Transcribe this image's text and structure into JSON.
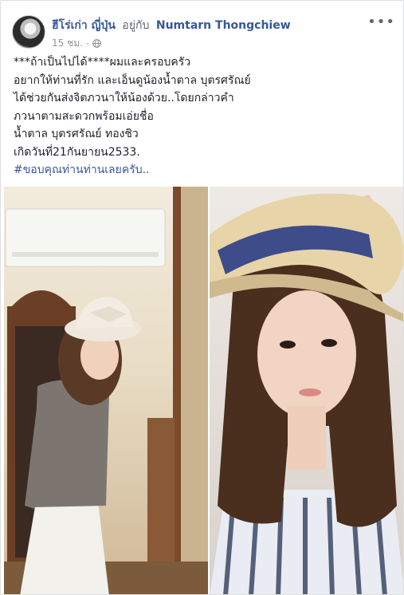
{
  "post": {
    "author": "ฮีโร่เก่า ญี่ปุ่น",
    "with_text": "อยู่กับ",
    "tagged_person": "Numtarn Thongchiew",
    "timestamp": "15 ชม.",
    "privacy_icon": "globe-icon",
    "more_icon": "more-options-icon",
    "lines": [
      "***ถ้าเป็นไปได้****ผมและครอบครัว",
      "อยากให้ท่านที่รัก และเอ็นดูน้องน้ำตาล บุตรศรัณย์",
      "ได้ช่วยกันส่งจิตภวนาให้น้องด้วย..โดยกล่าวคำ",
      "ภวนาตามสะดวกพร้อมเอ่ยชื่อ",
      "น้ำตาล บุตรศรัณย์ ทองชิว",
      "เกิดวันที่21กันยายน2533."
    ],
    "hashtag": "#ขอบคุณท่านท่านเลยครับ.."
  },
  "colors": {
    "link": "#365899",
    "text": "#1d2129",
    "meta": "#90949c",
    "background": "#ffffff"
  }
}
